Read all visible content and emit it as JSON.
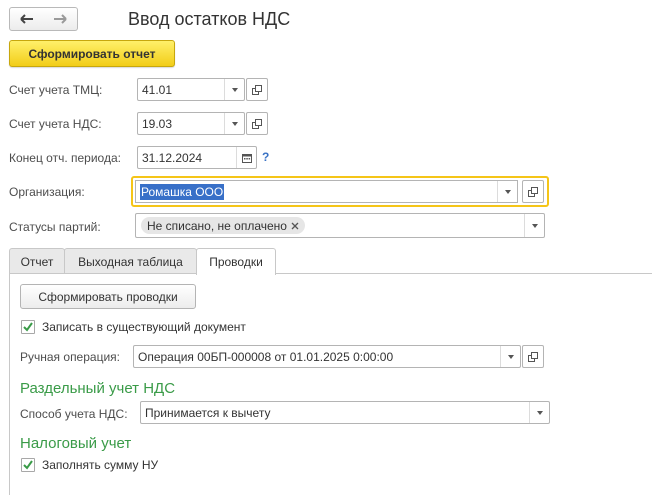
{
  "window": {
    "title": "Ввод остатков НДС"
  },
  "nav": {
    "back_icon": "arrow-left-icon",
    "forward_icon": "arrow-right-icon"
  },
  "toolbar": {
    "generate_report_label": "Сформировать отчет"
  },
  "form": {
    "tmc_account": {
      "label": "Счет учета ТМЦ:",
      "value": "41.01"
    },
    "vat_account": {
      "label": "Счет учета НДС:",
      "value": "19.03"
    },
    "period_end": {
      "label": "Конец отч. периода:",
      "value": "31.12.2024",
      "help": "?"
    },
    "organization": {
      "label": "Организация:",
      "value": "Ромашка ООО"
    },
    "party_statuses": {
      "label": "Статусы партий:",
      "tag": "Не списано, не оплачено"
    }
  },
  "tabs": [
    {
      "label": "Отчет",
      "active": false
    },
    {
      "label": "Выходная таблица",
      "active": false
    },
    {
      "label": "Проводки",
      "active": true
    }
  ],
  "postings": {
    "generate_button": "Сформировать проводки",
    "write_existing": {
      "label": "Записать в существующий документ",
      "checked": true
    },
    "manual_operation": {
      "label": "Ручная операция:",
      "value": "Операция 00БП-000008 от 01.01.2025 0:00:00"
    },
    "separate_vat_title": "Раздельный учет НДС",
    "vat_method": {
      "label": "Способ учета НДС:",
      "value": "Принимается к вычету"
    },
    "tax_title": "Налоговый учет",
    "fill_nu": {
      "label": "Заполнять сумму НУ",
      "checked": true
    }
  },
  "colors": {
    "accent_yellow": "#f2cd18",
    "section_green": "#3a9b48",
    "selection_blue": "#3870c8",
    "help_blue": "#3b73c5"
  }
}
